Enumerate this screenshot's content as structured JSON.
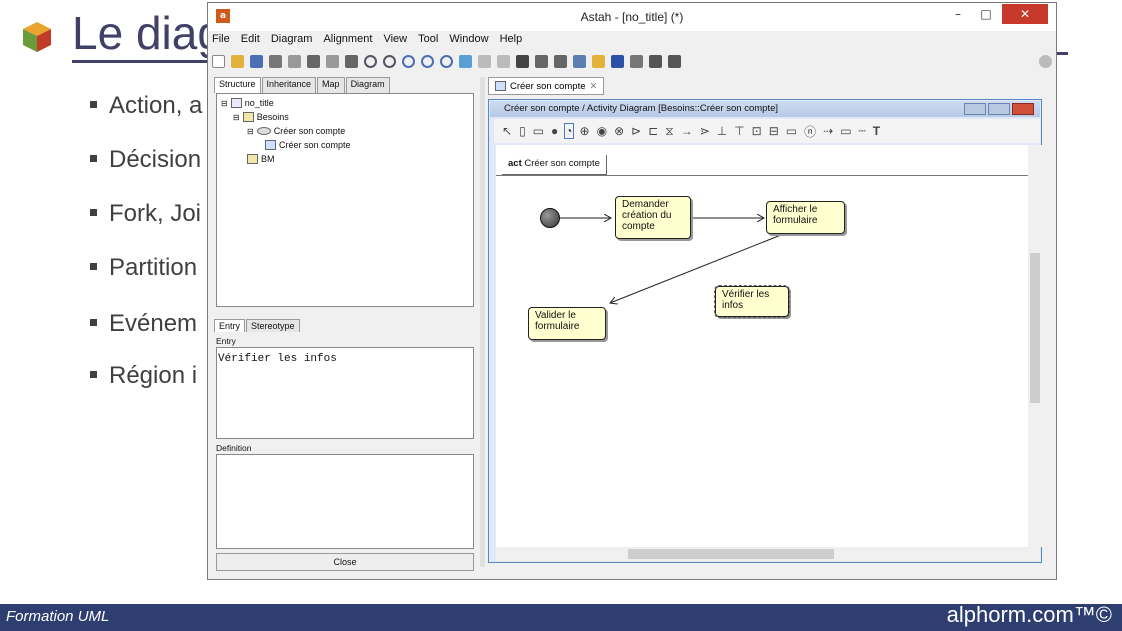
{
  "slide": {
    "title": "Le diag",
    "bullets": [
      "Action, a",
      "Décision",
      "Fork, Joi",
      "Partition",
      "Evénem",
      "Région i"
    ],
    "footer_left": "Formation UML",
    "footer_right": "alphorm.com™©"
  },
  "window": {
    "title": "Astah - [no_title] (*)",
    "minimize": "–",
    "maximize": "□",
    "close": "✕",
    "menu": [
      "File",
      "Edit",
      "Diagram",
      "Alignment",
      "View",
      "Tool",
      "Window",
      "Help"
    ]
  },
  "left_panel": {
    "tabs": [
      "Structure",
      "Inheritance",
      "Map",
      "Diagram"
    ],
    "tree": {
      "root": "no_title",
      "package": "Besoins",
      "usecase": "Créer son compte",
      "diagram": "Créer son compte",
      "package2": "BM"
    },
    "entry_tabs": [
      "Entry",
      "Stereotype"
    ],
    "entry_label": "Entry",
    "entry_value": "Vérifier les infos",
    "definition_label": "Definition",
    "close_label": "Close"
  },
  "diagram_panel": {
    "doc_tab": "Créer son compte",
    "inner_title": "Créer son compte / Activity Diagram [Besoins::Créer son compte]",
    "frame_keyword": "act",
    "frame_name": "Créer son compte",
    "nodes": {
      "demander": "Demander création du compte",
      "afficher": "Afficher le formulaire",
      "valider": "Valider le formulaire",
      "verifier": "Vérifier les infos"
    }
  }
}
